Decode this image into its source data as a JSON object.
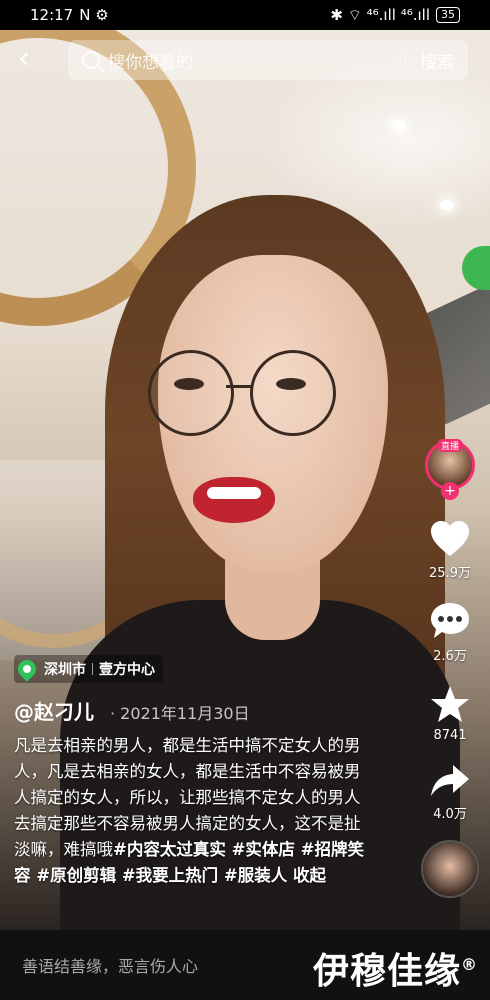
{
  "status_bar": {
    "time": "12:17",
    "left_icons": "N ⚙",
    "right_icons": "✱ ⌔ ⁴⁶.ıll ⁴⁶.ıll",
    "battery": "35"
  },
  "search": {
    "placeholder": "搜你想看的",
    "button_label": "搜索"
  },
  "rail": {
    "live_label": "直播",
    "like_count": "25.9万",
    "comment_count": "2.6万",
    "favorite_count": "8741",
    "share_count": "4.0万"
  },
  "location": {
    "city": "深圳市",
    "place": "壹方中心"
  },
  "post": {
    "author": "@赵刁儿",
    "date": "· 2021年11月30日",
    "text": "凡是去相亲的男人，都是生活中搞不定女人的男人，凡是去相亲的女人，都是生活中不容易被男人搞定的女人，所以，让那些搞不定女人的男人去搞定那些不容易被男人搞定的女人，这不是扯淡嘛，难搞哦",
    "hashtags": "#内容太过真实 #实体店 #招牌笑容 #原创剪辑 #我要上热门 #服装人 ",
    "collapse_label": "收起"
  },
  "bottom_bar": {
    "comment_placeholder": "善语结善缘，恶言伤人心"
  },
  "watermark": {
    "text": "伊穆佳缘",
    "mark": "®"
  },
  "colors": {
    "accent_pink": "#f0306f",
    "location_green": "#31c25a"
  }
}
